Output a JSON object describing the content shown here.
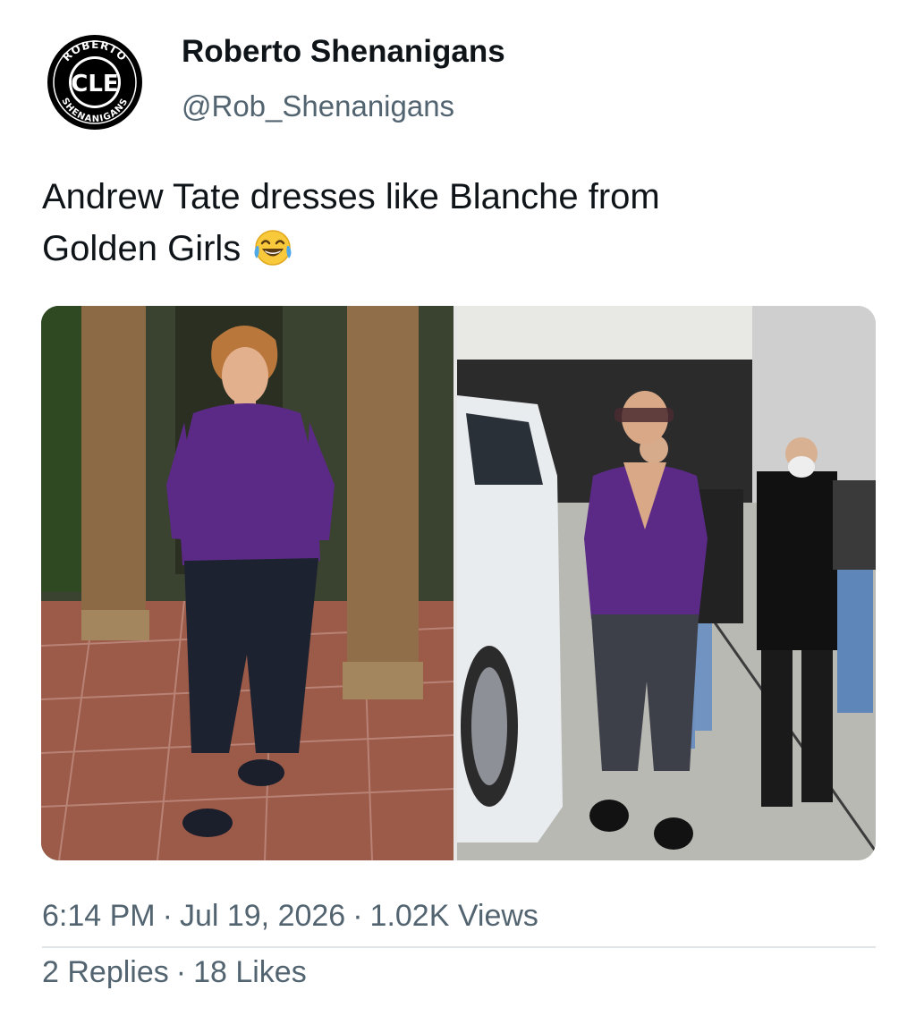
{
  "author": {
    "display_name": "Roberto Shenanigans",
    "handle": "@Rob_Shenanigans",
    "avatar": {
      "icon": "avatar-logo-icon",
      "ring_top_text": "ROBERTO",
      "ring_bottom_text": "SHENANIGANS",
      "center_text": "CLE"
    }
  },
  "tweet": {
    "text_line1": "Andrew Tate dresses like Blanche from",
    "text_line2": "Golden Girls",
    "emoji": "face-with-tears-of-joy-icon"
  },
  "media": {
    "left_photo": "person in purple shirt and dark cropped pants on patio",
    "right_photo": "bald man in purple shirt and grey cropped pants in garage"
  },
  "meta": {
    "time": "6:14 PM",
    "date": "Jul 19, 2026",
    "views": "1.02K Views",
    "separator": "·"
  },
  "stats": {
    "replies": "2 Replies",
    "likes": "18 Likes",
    "separator": "·"
  },
  "colors": {
    "text_primary": "#0f1419",
    "text_secondary": "#536471",
    "divider": "#e1e5e8",
    "shirt_purple": "#5b2a86"
  }
}
